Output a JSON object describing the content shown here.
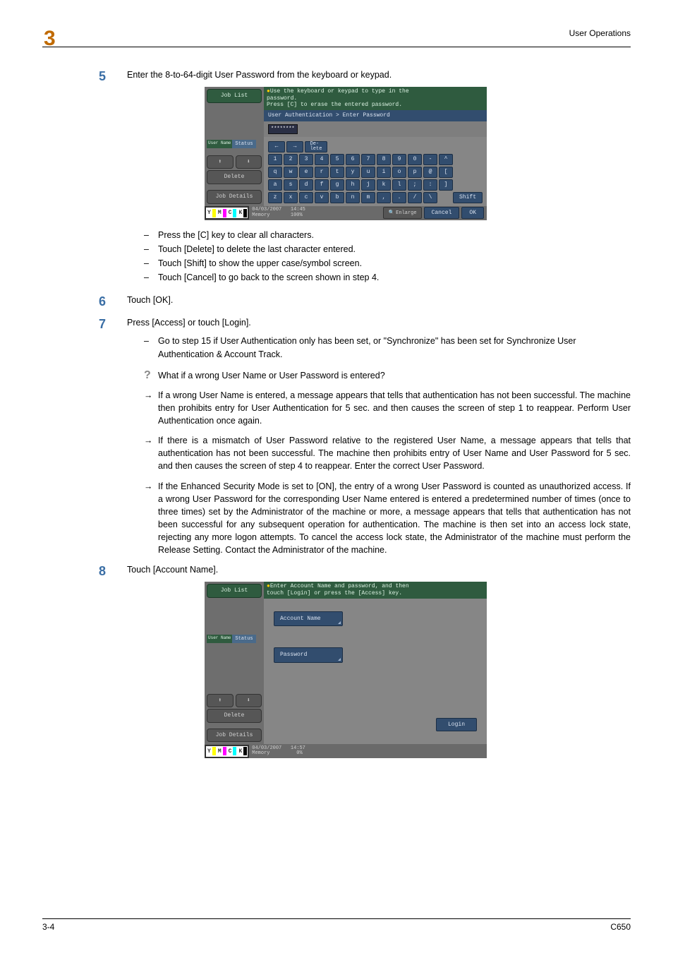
{
  "header": {
    "section": "User Operations",
    "chapter": "3"
  },
  "steps": {
    "s5": {
      "num": "5",
      "text": "Enter the 8-to-64-digit User Password from the keyboard or keypad.",
      "bullets": [
        "Press the [C] key to clear all characters.",
        "Touch [Delete] to delete the last character entered.",
        "Touch [Shift] to show the upper case/symbol screen.",
        "Touch [Cancel] to go back to the screen shown in step 4."
      ]
    },
    "s6": {
      "num": "6",
      "text": "Touch [OK]."
    },
    "s7": {
      "num": "7",
      "text": "Press [Access] or touch [Login].",
      "bullet": "Go to step 15 if User Authentication only has been set, or \"Synchronize\" has been set for Synchronize User Authentication & Account Track.",
      "question": "What if a wrong User Name or User Password is entered?",
      "arrow1": "If a wrong User Name is entered, a message appears that tells that authentication has not been successful. The machine then prohibits entry for User Authentication for 5 sec. and then causes the screen of step 1 to reappear. Perform User Authentication once again.",
      "arrow2": "If there is a mismatch of User Password relative to the registered User Name, a message appears that tells that authentication has not been successful. The machine then prohibits entry of User Name and User Password for 5 sec. and then causes the screen of step 4 to reappear. Enter the correct User Password.",
      "arrow3": "If the Enhanced Security Mode is set to [ON], the entry of a wrong User Password is counted as unauthorized access. If a wrong User Password for the corresponding User Name entered is entered a predetermined number of times (once to three times) set by the Administrator of the machine or more, a message appears that tells that authentication has not been successful for any subsequent operation for authentication. The machine is then set into an access lock state, rejecting any more logon attempts. To cancel the access lock state, the Administrator of the machine must perform the Release Setting. Contact the Administrator of the machine."
    },
    "s8": {
      "num": "8",
      "text": "Touch [Account Name]."
    }
  },
  "shot1": {
    "job_list": "Job List",
    "user_name": "User Name",
    "status": "Status",
    "delete": "Delete",
    "job_details": "Job Details",
    "info1": "Use the keyboard or keypad to type in the",
    "info2": "password.",
    "info3": "Press [C] to erase the entered password.",
    "crumb": "User Authentication > Enter Password",
    "masked": "********",
    "del_key": "De-\nlete",
    "row1": [
      "1",
      "2",
      "3",
      "4",
      "5",
      "6",
      "7",
      "8",
      "9",
      "0",
      "-",
      "^"
    ],
    "row2": [
      "q",
      "w",
      "e",
      "r",
      "t",
      "y",
      "u",
      "i",
      "o",
      "p",
      "@",
      "["
    ],
    "row3": [
      "a",
      "s",
      "d",
      "f",
      "g",
      "h",
      "j",
      "k",
      "l",
      ";",
      ":",
      "]"
    ],
    "row4": [
      "z",
      "x",
      "c",
      "v",
      "b",
      "n",
      "m",
      ",",
      ".",
      "/",
      "\\"
    ],
    "shift": "Shift",
    "date": "04/03/2007",
    "time": "14:45",
    "mem_label": "Memory",
    "mem_val": "100%",
    "enlarge": "Enlarge",
    "cancel": "Cancel",
    "ok": "OK"
  },
  "shot2": {
    "job_list": "Job List",
    "user_name": "User Name",
    "status": "Status",
    "delete": "Delete",
    "job_details": "Job Details",
    "info1": "Enter Account Name and password, and then",
    "info2": "touch [Login] or press the [Access] key.",
    "account": "Account Name",
    "password": "Password",
    "login": "Login",
    "date": "04/03/2007",
    "time": "14:57",
    "mem_label": "Memory",
    "mem_val": "0%"
  },
  "ymck": {
    "y": "Y",
    "m": "M",
    "c": "C",
    "k": "K"
  },
  "footer": {
    "page": "3-4",
    "model": "C650"
  }
}
